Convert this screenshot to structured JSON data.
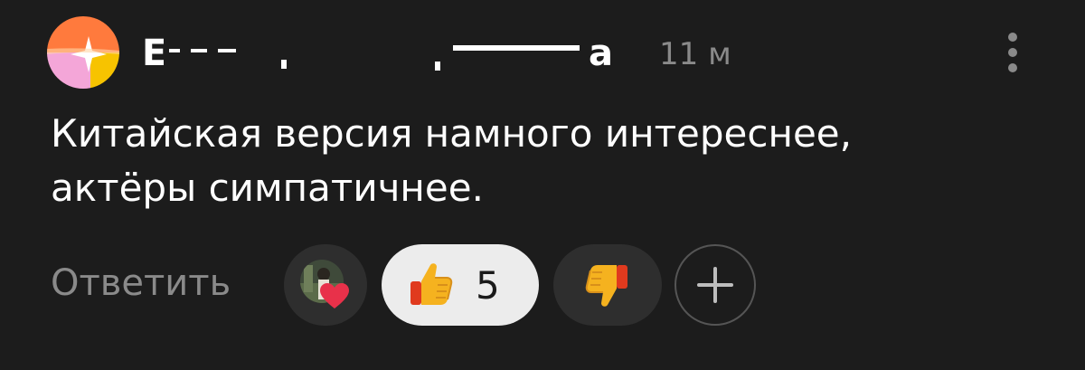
{
  "comment": {
    "author": {
      "name_visible": "Е",
      "name_tail_visible": "а"
    },
    "timestamp": "11 м",
    "text_line1": "Китайская версия намного интереснее,",
    "text_line2": "актёры симпатичнее.",
    "reply_label": "Ответить",
    "reactions": {
      "author_heart": {
        "icon": "heart-icon",
        "color": "#e8314a"
      },
      "like": {
        "icon": "thumbs-up-icon",
        "count": "5"
      },
      "dislike": {
        "icon": "thumbs-down-icon"
      },
      "add": {
        "icon": "plus-icon"
      }
    },
    "more_icon": "vertical-dots-icon"
  },
  "colors": {
    "background": "#1c1c1c",
    "secondary_text": "#8a8a8a",
    "pill_dark": "#2e2e2e",
    "pill_light": "#ececec",
    "emoji_yellow": "#f5b21f"
  }
}
